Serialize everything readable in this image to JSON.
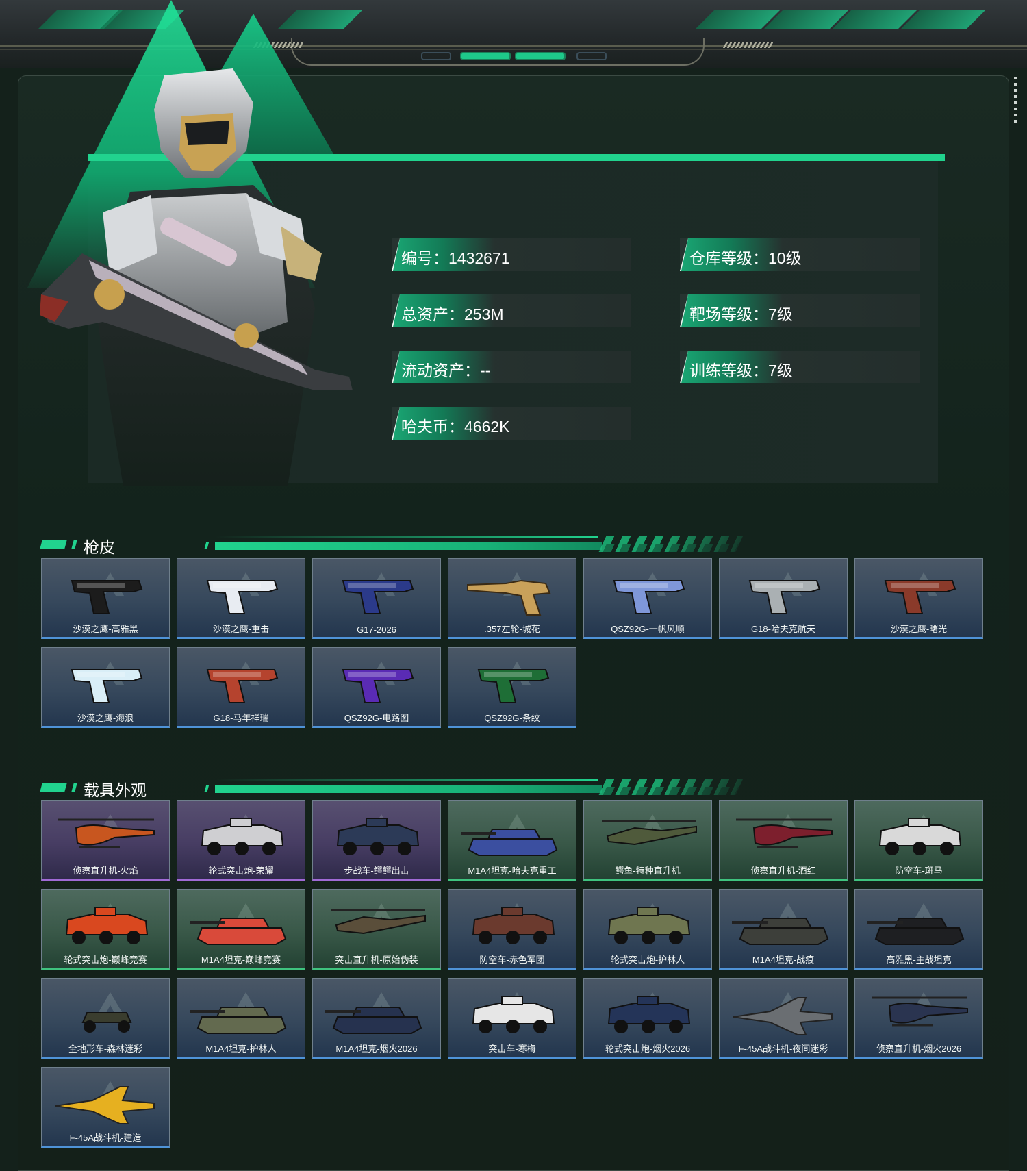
{
  "player": {
    "stats_left": [
      {
        "label": "编号",
        "value": "1432671"
      },
      {
        "label": "总资产",
        "value": "253M"
      },
      {
        "label": "流动资产",
        "value": "--"
      },
      {
        "label": "哈夫币",
        "value": "4662K"
      }
    ],
    "stats_right": [
      {
        "label": "仓库等级",
        "value": "10级"
      },
      {
        "label": "靶场等级",
        "value": "7级"
      },
      {
        "label": "训练等级",
        "value": "7级"
      }
    ]
  },
  "gun_skins": {
    "title": "枪皮",
    "items": [
      {
        "name": "沙漠之鹰-高雅黑",
        "rarity": "blue",
        "icon": "pistol-deagle-black-icon",
        "color": "#1c1c1c"
      },
      {
        "name": "沙漠之鹰-重击",
        "rarity": "blue",
        "icon": "pistol-deagle-white-blue-icon",
        "color": "#e8ecf2"
      },
      {
        "name": "G17-2026",
        "rarity": "blue",
        "icon": "pistol-g17-blue-icon",
        "color": "#2b3a8a"
      },
      {
        "name": ".357左轮-城花",
        "rarity": "blue",
        "icon": "revolver-gold-icon",
        "color": "#c9a15a"
      },
      {
        "name": "QSZ92G-一帆风顺",
        "rarity": "blue",
        "icon": "pistol-qsz92g-blue-icon",
        "color": "#7f97d9"
      },
      {
        "name": "G18-哈夫克航天",
        "rarity": "blue",
        "icon": "pistol-g18-grey-icon",
        "color": "#aab0b3"
      },
      {
        "name": "沙漠之鹰-曙光",
        "rarity": "blue",
        "icon": "pistol-deagle-red-icon",
        "color": "#8a3a2a"
      },
      {
        "name": "沙漠之鹰-海浪",
        "rarity": "blue",
        "icon": "pistol-deagle-wave-icon",
        "color": "#d9eef7"
      },
      {
        "name": "G18-马年祥瑞",
        "rarity": "blue",
        "icon": "pistol-g18-red-icon",
        "color": "#b5432e"
      },
      {
        "name": "QSZ92G-电路图",
        "rarity": "blue",
        "icon": "pistol-qsz92g-purple-icon",
        "color": "#5a2bb4"
      },
      {
        "name": "QSZ92G-条纹",
        "rarity": "blue",
        "icon": "pistol-qsz92g-green-icon",
        "color": "#1e6e36"
      }
    ]
  },
  "vehicle_skins": {
    "title": "载具外观",
    "items": [
      {
        "name": "侦察直升机-火焰",
        "rarity": "purple",
        "icon": "helicopter-icon",
        "color": "#c8561f"
      },
      {
        "name": "轮式突击炮-荣耀",
        "rarity": "purple",
        "icon": "wheeled-assault-gun-icon",
        "color": "#cfcfd2"
      },
      {
        "name": "步战车-鳄鳄出击",
        "rarity": "purple",
        "icon": "ifv-icon",
        "color": "#2c3a57"
      },
      {
        "name": "M1A4坦克-哈夫克重工",
        "rarity": "green",
        "icon": "tank-icon",
        "color": "#3b4fa0"
      },
      {
        "name": "鳄鱼-特种直升机",
        "rarity": "green",
        "icon": "attack-helicopter-icon",
        "color": "#4f5a3b"
      },
      {
        "name": "侦察直升机-酒红",
        "rarity": "green",
        "icon": "helicopter-icon",
        "color": "#7d1f2d"
      },
      {
        "name": "防空车-斑马",
        "rarity": "green",
        "icon": "aa-vehicle-icon",
        "color": "#d9d9d9"
      },
      {
        "name": "轮式突击炮-巅峰竞赛",
        "rarity": "green",
        "icon": "wheeled-assault-gun-icon",
        "color": "#d9481f"
      },
      {
        "name": "M1A4坦克-巅峰竞赛",
        "rarity": "green",
        "icon": "tank-icon",
        "color": "#d94a3a"
      },
      {
        "name": "突击直升机-原始伪装",
        "rarity": "green",
        "icon": "attack-helicopter-icon",
        "color": "#5a4e3a"
      },
      {
        "name": "防空车-赤色军团",
        "rarity": "blue",
        "icon": "aa-vehicle-icon",
        "color": "#6b3a2e"
      },
      {
        "name": "轮式突击炮-护林人",
        "rarity": "blue",
        "icon": "wheeled-assault-gun-icon",
        "color": "#6f7650"
      },
      {
        "name": "M1A4坦克-战痕",
        "rarity": "blue",
        "icon": "tank-icon",
        "color": "#3d3f3a"
      },
      {
        "name": "高雅黑-主战坦克",
        "rarity": "blue",
        "icon": "tank-icon",
        "color": "#1e1f22"
      },
      {
        "name": "全地形车-森林迷彩",
        "rarity": "blue",
        "icon": "atv-icon",
        "color": "#3a3d2e"
      },
      {
        "name": "M1A4坦克-护林人",
        "rarity": "blue",
        "icon": "tank-icon",
        "color": "#636a4f"
      },
      {
        "name": "M1A4坦克-烟火2026",
        "rarity": "blue",
        "icon": "tank-icon",
        "color": "#26324f"
      },
      {
        "name": "突击车-寒梅",
        "rarity": "blue",
        "icon": "assault-car-icon",
        "color": "#e6e6e6"
      },
      {
        "name": "轮式突击炮-烟火2026",
        "rarity": "blue",
        "icon": "wheeled-assault-gun-icon",
        "color": "#243458"
      },
      {
        "name": "F-45A战斗机-夜间迷彩",
        "rarity": "blue",
        "icon": "fighter-jet-icon",
        "color": "#6a6e72"
      },
      {
        "name": "侦察直升机-烟火2026",
        "rarity": "blue",
        "icon": "helicopter-icon",
        "color": "#2a3450"
      },
      {
        "name": "F-45A战斗机-建造",
        "rarity": "blue",
        "icon": "fighter-jet-icon",
        "color": "#e6b020"
      }
    ]
  }
}
